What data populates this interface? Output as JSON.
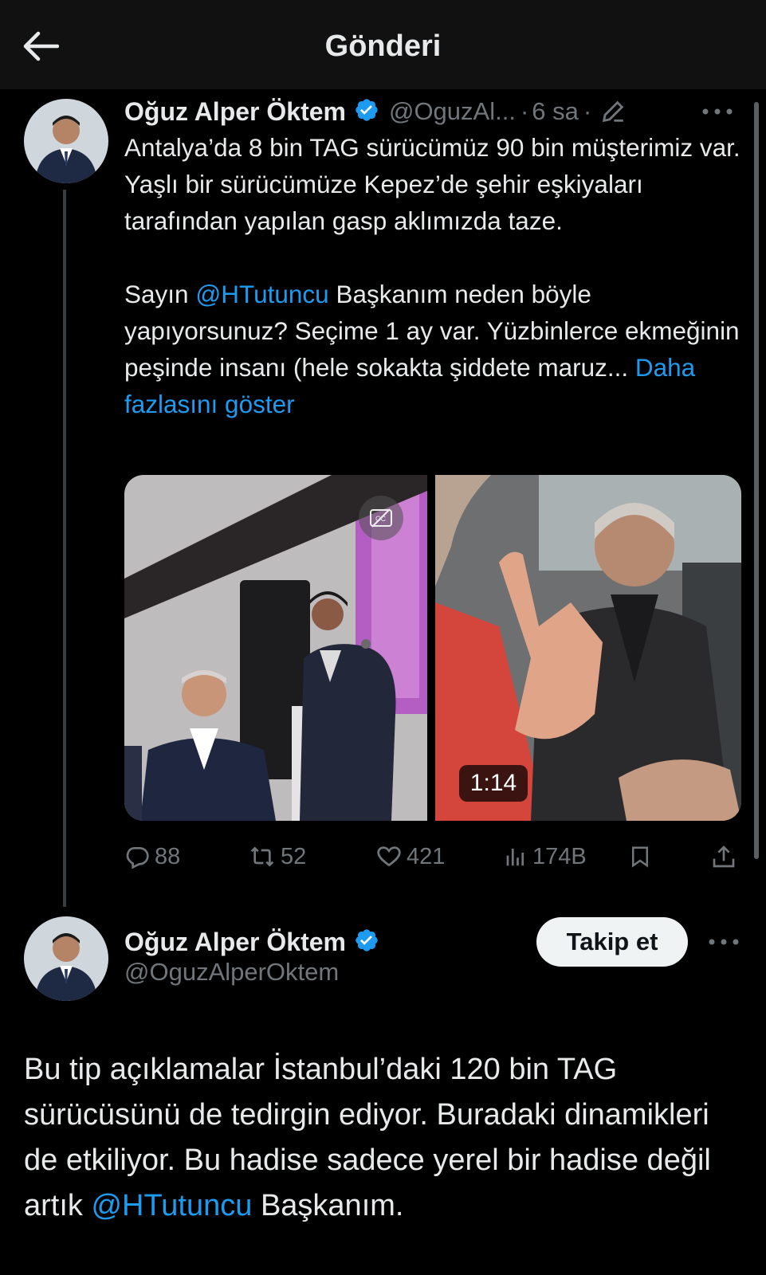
{
  "header": {
    "title": "Gönderi"
  },
  "tweet": {
    "author_name": "Oğuz Alper Öktem",
    "handle_truncated": "@OguzAl...",
    "time": "6 sa",
    "text_p1": "Antalya’da 8 bin TAG sürücümüz 90 bin müşterimiz var. Yaşlı bir sürücümüze Kepez’de şehir eşkiyaları tarafından yapılan gasp aklımızda taze.",
    "text_p2_before": "Sayın ",
    "text_p2_mention": "@HTutuncu",
    "text_p2_after": " Başkanım neden böyle yapıyorsunuz? Seçime 1 ay var. Yüzbinlerce ekmeğinin peşinde insanı (hele sokakta şiddete maruz... ",
    "show_more": "Daha fazlasını göster",
    "video_duration": "1:14",
    "replies": "88",
    "reposts": "52",
    "likes": "421",
    "views": "174B"
  },
  "reply": {
    "author_name": "Oğuz Alper Öktem",
    "handle": "@OguzAlperOktem",
    "follow_label": "Takip et",
    "text_before": "Bu tip açıklamalar İstanbul’daki 120 bin TAG sürücüsünü de tedirgin ediyor. Buradaki dinamikleri de etkiliyor. Bu hadise sadece yerel bir hadise değil artık ",
    "text_mention": "@HTutuncu",
    "text_after": " Başkanım."
  },
  "colors": {
    "accent": "#1d9bf0",
    "background": "#000000",
    "header_bg": "#111111",
    "muted": "#71767b"
  },
  "icons": [
    "back-arrow-icon",
    "verified-badge-icon",
    "edit-pencil-icon",
    "more-icon",
    "captions-icon",
    "reply-icon",
    "repost-icon",
    "like-icon",
    "views-icon",
    "bookmark-icon",
    "share-icon"
  ]
}
